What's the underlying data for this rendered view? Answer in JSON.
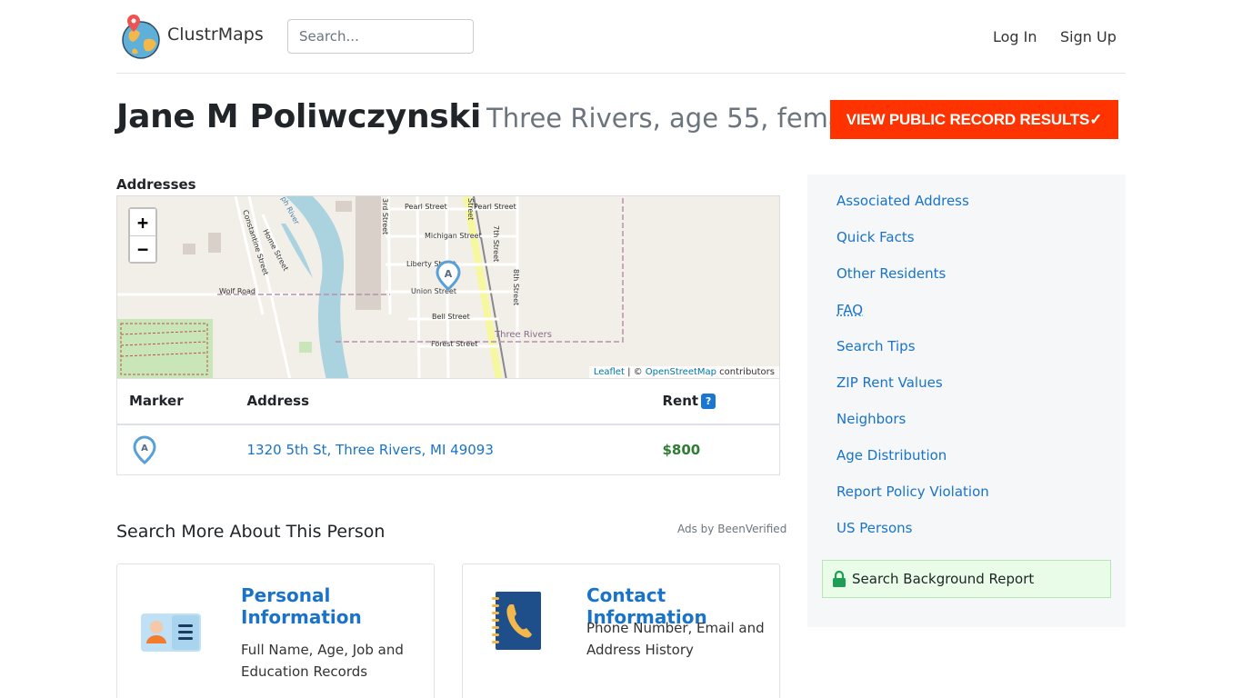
{
  "header": {
    "brand": "ClustrMaps",
    "search_placeholder": "Search...",
    "login": "Log In",
    "signup": "Sign Up"
  },
  "person": {
    "name": "Jane M Poliwczynski",
    "subtitle": "Three Rivers, age 55, female"
  },
  "cta": {
    "label": "VIEW PUBLIC RECORD RESULTS✓"
  },
  "addresses": {
    "section_label": "Addresses",
    "map": {
      "zoom_in": "+",
      "zoom_out": "−",
      "attribution": {
        "leaflet": "Leaflet",
        "sep": " | © ",
        "osm": "OpenStreetMap",
        "suffix": " contributors"
      },
      "marker_label": "A",
      "labels": {
        "pearl1": "Pearl Street",
        "pearl2": "Pearl Street",
        "michigan": "Michigan Street",
        "liberty": "Liberty Street",
        "union": "Union Street",
        "bell": "Bell Street",
        "forest": "Forest Street",
        "wolf": "Wolf Road",
        "threerivers": "Three Rivers",
        "third": "3rd Street",
        "fifth": "Street",
        "seventh": "7th Street",
        "eighth": "8th Street",
        "constantine": "Constantine Street",
        "home": "Home Street",
        "river": "ph River"
      }
    },
    "table": {
      "headers": {
        "marker": "Marker",
        "address": "Address",
        "rent": "Rent",
        "rent_help": "?"
      },
      "rows": [
        {
          "marker": "A",
          "address": "1320 5th St, Three Rivers, MI 49093",
          "rent": "$800"
        }
      ]
    }
  },
  "search_more": {
    "title": "Search More About This Person",
    "ads": "Ads by BeenVerified",
    "cards": [
      {
        "title": "Personal Information",
        "desc": "Full Name, Age, Job and Education Records"
      },
      {
        "title": "Contact Information",
        "desc": "Phone Number, Email and Address History"
      }
    ]
  },
  "sidebar": {
    "items": [
      "Associated Address",
      "Quick Facts",
      "Other Residents",
      "FAQ",
      "Search Tips",
      "ZIP Rent Values",
      "Neighbors",
      "Age Distribution",
      "Report Policy Violation",
      "US Persons"
    ],
    "background_report": "Search Background Report"
  }
}
